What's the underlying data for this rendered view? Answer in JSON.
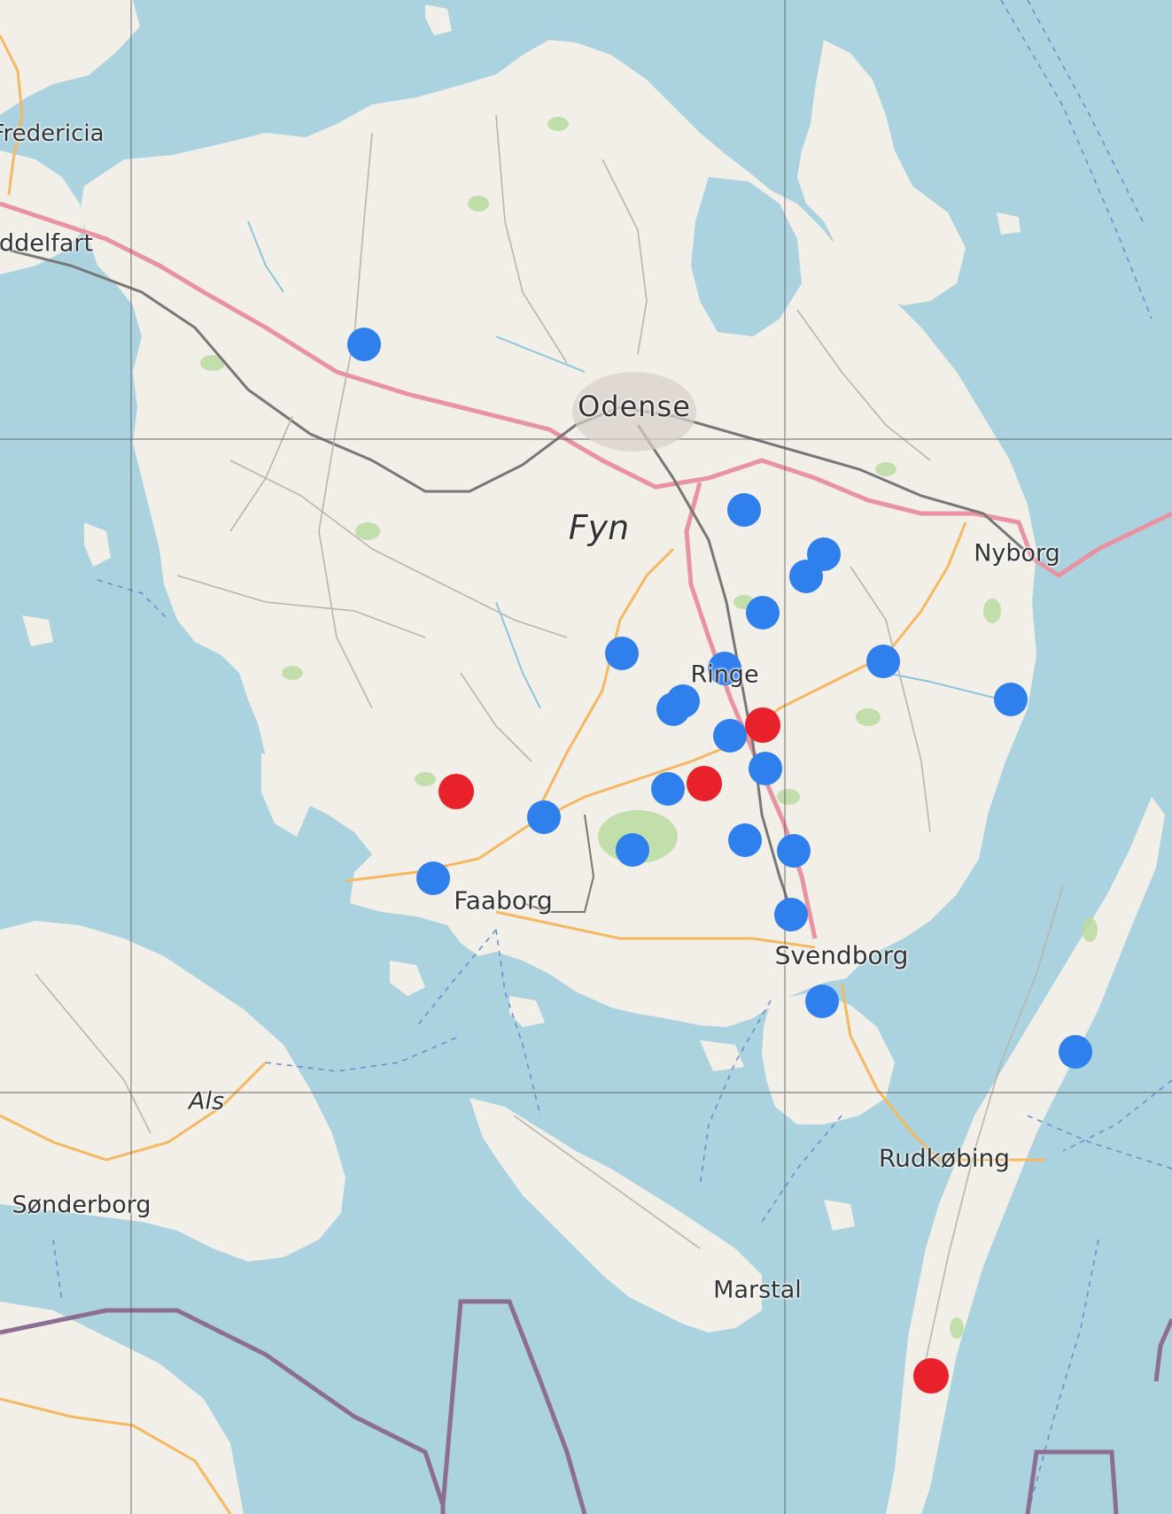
{
  "place_labels": {
    "odense": "Odense",
    "fyn": "Fyn",
    "nyborg": "Nyborg",
    "ringe": "Ringe",
    "faaborg": "Faaborg",
    "svendborg": "Svendborg",
    "rudkobing": "Rudkøbing",
    "marstal": "Marstal",
    "als": "Als",
    "sonderborg": "Sønderborg",
    "fredericia": "Fredericia",
    "middelfart": "ddelfart"
  },
  "colors": {
    "water": "#aad3df",
    "land": "#f2efe9",
    "forest": "#b8dba0",
    "motorway": "#e892a2",
    "primary_road": "#f5b860",
    "railway": "#777777",
    "border": "#8e6d92",
    "ferry": "#6a8fd0",
    "grid": "#555555",
    "marker_blue": "#2f80ed",
    "marker_red": "#e8212a"
  },
  "markers_summary": {
    "blue_count": 24,
    "red_count": 4
  }
}
